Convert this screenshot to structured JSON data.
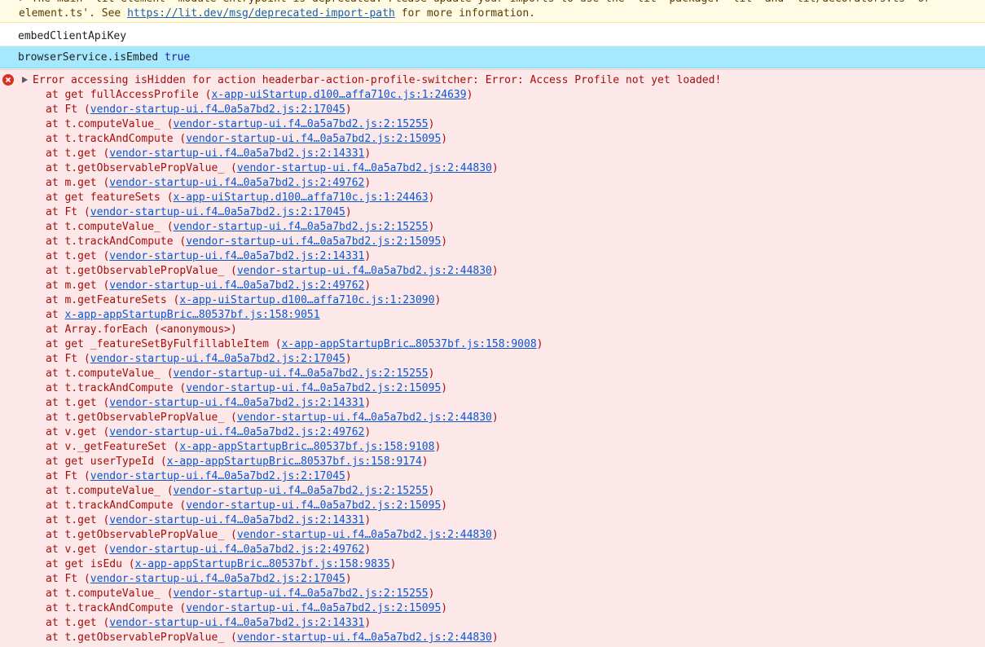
{
  "warning": {
    "line1": "▸ The main 'lit-element' module entrypoint is deprecated. Please update your imports to use the 'lit' package: 'lit' and 'lit/decorators.ts' or",
    "line2_prefix": "element.ts'. See ",
    "line2_link": "https://lit.dev/msg/deprecated-import-path",
    "line2_suffix": " for more information."
  },
  "logs": [
    {
      "text": "embedClientApiKey"
    },
    {
      "label": "browserService.isEmbed",
      "value": "true"
    }
  ],
  "error": {
    "message": "Error accessing isHidden for action headerbar-action-profile-switcher: Error: Access Profile not yet loaded!",
    "frames": [
      {
        "fn": "get fullAccessProfile",
        "loc": "x-app-uiStartup.d100…affa710c.js:1:24639",
        "paren": true
      },
      {
        "fn": "Ft",
        "loc": "vendor-startup-ui.f4…0a5a7bd2.js:2:17045",
        "paren": true
      },
      {
        "fn": "t.computeValue_",
        "loc": "vendor-startup-ui.f4…0a5a7bd2.js:2:15255",
        "paren": true
      },
      {
        "fn": "t.trackAndCompute",
        "loc": "vendor-startup-ui.f4…0a5a7bd2.js:2:15095",
        "paren": true
      },
      {
        "fn": "t.get",
        "loc": "vendor-startup-ui.f4…0a5a7bd2.js:2:14331",
        "paren": true
      },
      {
        "fn": "t.getObservablePropValue_",
        "loc": "vendor-startup-ui.f4…0a5a7bd2.js:2:44830",
        "paren": true
      },
      {
        "fn": "m.get",
        "loc": "vendor-startup-ui.f4…0a5a7bd2.js:2:49762",
        "paren": true
      },
      {
        "fn": "get featureSets",
        "loc": "x-app-uiStartup.d100…affa710c.js:1:24463",
        "paren": true
      },
      {
        "fn": "Ft",
        "loc": "vendor-startup-ui.f4…0a5a7bd2.js:2:17045",
        "paren": true
      },
      {
        "fn": "t.computeValue_",
        "loc": "vendor-startup-ui.f4…0a5a7bd2.js:2:15255",
        "paren": true
      },
      {
        "fn": "t.trackAndCompute",
        "loc": "vendor-startup-ui.f4…0a5a7bd2.js:2:15095",
        "paren": true
      },
      {
        "fn": "t.get",
        "loc": "vendor-startup-ui.f4…0a5a7bd2.js:2:14331",
        "paren": true
      },
      {
        "fn": "t.getObservablePropValue_",
        "loc": "vendor-startup-ui.f4…0a5a7bd2.js:2:44830",
        "paren": true
      },
      {
        "fn": "m.get",
        "loc": "vendor-startup-ui.f4…0a5a7bd2.js:2:49762",
        "paren": true
      },
      {
        "fn": "m.getFeatureSets",
        "loc": "x-app-uiStartup.d100…affa710c.js:1:23090",
        "paren": true
      },
      {
        "fn": "",
        "loc": "x-app-appStartupBric…80537bf.js:158:9051",
        "paren": false
      },
      {
        "fn": "Array.forEach (<anonymous>)",
        "loc": "",
        "paren": false
      },
      {
        "fn": "get _featureSetByFulfillableItem",
        "loc": "x-app-appStartupBric…80537bf.js:158:9008",
        "paren": true
      },
      {
        "fn": "Ft",
        "loc": "vendor-startup-ui.f4…0a5a7bd2.js:2:17045",
        "paren": true
      },
      {
        "fn": "t.computeValue_",
        "loc": "vendor-startup-ui.f4…0a5a7bd2.js:2:15255",
        "paren": true
      },
      {
        "fn": "t.trackAndCompute",
        "loc": "vendor-startup-ui.f4…0a5a7bd2.js:2:15095",
        "paren": true
      },
      {
        "fn": "t.get",
        "loc": "vendor-startup-ui.f4…0a5a7bd2.js:2:14331",
        "paren": true
      },
      {
        "fn": "t.getObservablePropValue_",
        "loc": "vendor-startup-ui.f4…0a5a7bd2.js:2:44830",
        "paren": true
      },
      {
        "fn": "v.get",
        "loc": "vendor-startup-ui.f4…0a5a7bd2.js:2:49762",
        "paren": true
      },
      {
        "fn": "v._getFeatureSet",
        "loc": "x-app-appStartupBric…80537bf.js:158:9108",
        "paren": true
      },
      {
        "fn": "get userTypeId",
        "loc": "x-app-appStartupBric…80537bf.js:158:9174",
        "paren": true
      },
      {
        "fn": "Ft",
        "loc": "vendor-startup-ui.f4…0a5a7bd2.js:2:17045",
        "paren": true
      },
      {
        "fn": "t.computeValue_",
        "loc": "vendor-startup-ui.f4…0a5a7bd2.js:2:15255",
        "paren": true
      },
      {
        "fn": "t.trackAndCompute",
        "loc": "vendor-startup-ui.f4…0a5a7bd2.js:2:15095",
        "paren": true
      },
      {
        "fn": "t.get",
        "loc": "vendor-startup-ui.f4…0a5a7bd2.js:2:14331",
        "paren": true
      },
      {
        "fn": "t.getObservablePropValue_",
        "loc": "vendor-startup-ui.f4…0a5a7bd2.js:2:44830",
        "paren": true
      },
      {
        "fn": "v.get",
        "loc": "vendor-startup-ui.f4…0a5a7bd2.js:2:49762",
        "paren": true
      },
      {
        "fn": "get isEdu",
        "loc": "x-app-appStartupBric…80537bf.js:158:9835",
        "paren": true
      },
      {
        "fn": "Ft",
        "loc": "vendor-startup-ui.f4…0a5a7bd2.js:2:17045",
        "paren": true
      },
      {
        "fn": "t.computeValue_",
        "loc": "vendor-startup-ui.f4…0a5a7bd2.js:2:15255",
        "paren": true
      },
      {
        "fn": "t.trackAndCompute",
        "loc": "vendor-startup-ui.f4…0a5a7bd2.js:2:15095",
        "paren": true
      },
      {
        "fn": "t.get",
        "loc": "vendor-startup-ui.f4…0a5a7bd2.js:2:14331",
        "paren": true
      },
      {
        "fn": "t.getObservablePropValue_",
        "loc": "vendor-startup-ui.f4…0a5a7bd2.js:2:44830",
        "paren": true
      }
    ]
  }
}
